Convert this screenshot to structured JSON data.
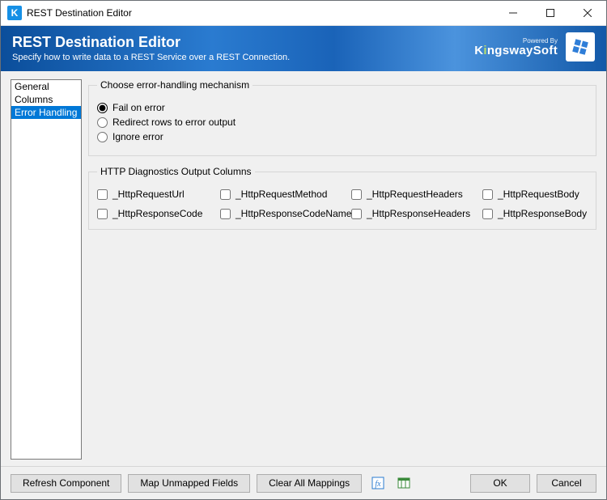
{
  "titlebar": {
    "title": "REST Destination Editor"
  },
  "header": {
    "title": "REST Destination Editor",
    "subtitle": "Specify how to write data to a REST Service over a REST Connection.",
    "brand_powered": "Powered By",
    "brand_name_pre": "K",
    "brand_name_accent": "i",
    "brand_name_post": "ngswaySoft"
  },
  "sidebar": {
    "items": [
      {
        "label": "General",
        "selected": false
      },
      {
        "label": "Columns",
        "selected": false
      },
      {
        "label": "Error Handling",
        "selected": true
      }
    ]
  },
  "errorHandling": {
    "legend": "Choose error-handling mechanism",
    "options": [
      {
        "label": "Fail on error",
        "checked": true
      },
      {
        "label": "Redirect rows to error output",
        "checked": false
      },
      {
        "label": "Ignore error",
        "checked": false
      }
    ]
  },
  "diagnostics": {
    "legend": "HTTP Diagnostics Output Columns",
    "columns": [
      {
        "label": "_HttpRequestUrl",
        "checked": false
      },
      {
        "label": "_HttpRequestMethod",
        "checked": false
      },
      {
        "label": "_HttpRequestHeaders",
        "checked": false
      },
      {
        "label": "_HttpRequestBody",
        "checked": false
      },
      {
        "label": "_HttpResponseCode",
        "checked": false
      },
      {
        "label": "_HttpResponseCodeName",
        "checked": false
      },
      {
        "label": "_HttpResponseHeaders",
        "checked": false
      },
      {
        "label": "_HttpResponseBody",
        "checked": false
      }
    ]
  },
  "footer": {
    "refresh": "Refresh Component",
    "map": "Map Unmapped Fields",
    "clear": "Clear All Mappings",
    "ok": "OK",
    "cancel": "Cancel"
  }
}
